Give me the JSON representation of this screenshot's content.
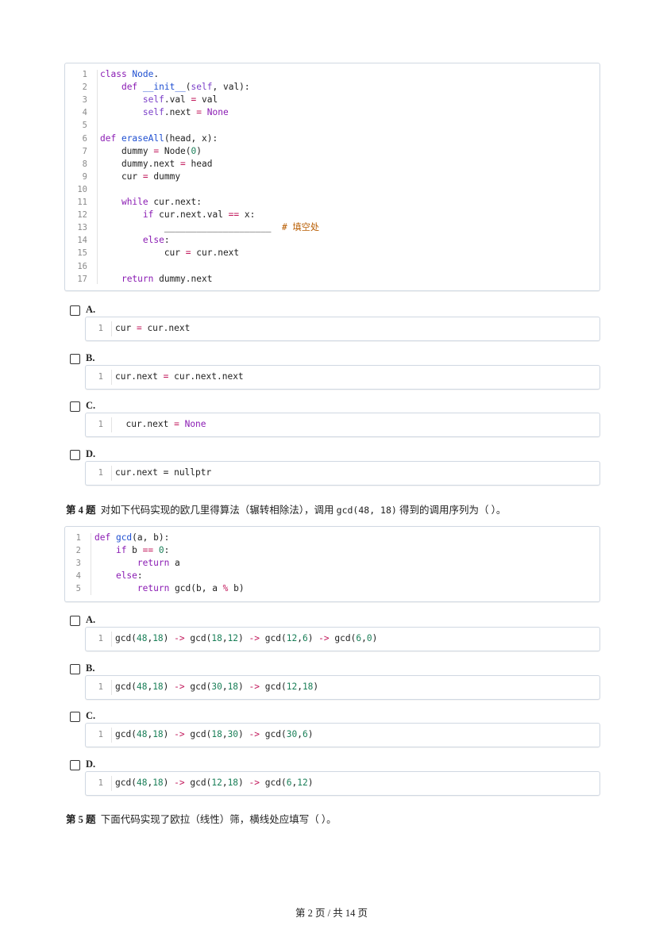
{
  "code1": {
    "lines": [
      {
        "n": "1",
        "parts": [
          [
            "kw",
            "class "
          ],
          [
            "fn",
            "Node"
          ],
          [
            "",
            "."
          ]
        ]
      },
      {
        "n": "2",
        "parts": [
          [
            "",
            "    "
          ],
          [
            "kw",
            "def "
          ],
          [
            "fn",
            "__init__"
          ],
          [
            "",
            "("
          ],
          [
            "slf",
            "self"
          ],
          [
            "",
            ", val):"
          ]
        ]
      },
      {
        "n": "3",
        "parts": [
          [
            "",
            "        "
          ],
          [
            "slf",
            "self"
          ],
          [
            "",
            ".val "
          ],
          [
            "op",
            "="
          ],
          [
            "",
            " val"
          ]
        ]
      },
      {
        "n": "4",
        "parts": [
          [
            "",
            "        "
          ],
          [
            "slf",
            "self"
          ],
          [
            "",
            ".next "
          ],
          [
            "op",
            "="
          ],
          [
            "kw",
            " None"
          ]
        ]
      },
      {
        "n": "5",
        "parts": []
      },
      {
        "n": "6",
        "parts": [
          [
            "kw",
            "def "
          ],
          [
            "fn",
            "eraseAll"
          ],
          [
            "",
            "(head, x):"
          ]
        ]
      },
      {
        "n": "7",
        "parts": [
          [
            "",
            "    dummy "
          ],
          [
            "op",
            "="
          ],
          [
            "",
            " Node("
          ],
          [
            "num",
            "0"
          ],
          [
            "",
            ")"
          ]
        ]
      },
      {
        "n": "8",
        "parts": [
          [
            "",
            "    dummy.next "
          ],
          [
            "op",
            "="
          ],
          [
            "",
            " head"
          ]
        ]
      },
      {
        "n": "9",
        "parts": [
          [
            "",
            "    cur "
          ],
          [
            "op",
            "="
          ],
          [
            "",
            " dummy"
          ]
        ]
      },
      {
        "n": "10",
        "parts": []
      },
      {
        "n": "11",
        "parts": [
          [
            "",
            "    "
          ],
          [
            "kw",
            "while"
          ],
          [
            "",
            " cur.next:"
          ]
        ]
      },
      {
        "n": "12",
        "parts": [
          [
            "",
            "        "
          ],
          [
            "kw",
            "if"
          ],
          [
            "",
            " cur.next.val "
          ],
          [
            "op",
            "=="
          ],
          [
            "",
            " x:"
          ]
        ]
      },
      {
        "n": "13",
        "parts": [
          [
            "",
            "            ____________________  "
          ],
          [
            "cm",
            "# 填空处"
          ]
        ]
      },
      {
        "n": "14",
        "parts": [
          [
            "",
            "        "
          ],
          [
            "kw",
            "else"
          ],
          [
            "",
            ":"
          ]
        ]
      },
      {
        "n": "15",
        "parts": [
          [
            "",
            "            cur "
          ],
          [
            "op",
            "="
          ],
          [
            "",
            " cur.next"
          ]
        ]
      },
      {
        "n": "16",
        "parts": []
      },
      {
        "n": "17",
        "parts": [
          [
            "",
            "    "
          ],
          [
            "kw",
            "return"
          ],
          [
            "",
            " dummy.next"
          ]
        ]
      }
    ]
  },
  "q3_options": [
    {
      "label": "A.",
      "n": "1",
      "parts": [
        [
          "",
          "cur "
        ],
        [
          "op",
          "="
        ],
        [
          "",
          " cur.next"
        ]
      ]
    },
    {
      "label": "B.",
      "n": "1",
      "parts": [
        [
          "",
          "cur.next "
        ],
        [
          "op",
          "="
        ],
        [
          "",
          " cur.next.next"
        ]
      ]
    },
    {
      "label": "C.",
      "n": "1",
      "parts": [
        [
          "",
          "  cur.next "
        ],
        [
          "op",
          "="
        ],
        [
          "kw",
          " None"
        ]
      ]
    },
    {
      "label": "D.",
      "n": "1",
      "parts": [
        [
          "",
          "cur.next = nullptr"
        ]
      ]
    }
  ],
  "q4": {
    "number": "第 4 题",
    "text_before": "对如下代码实现的欧几里得算法（辗转相除法），调用 ",
    "inline_code": "gcd(48, 18)",
    "text_after": " 得到的调用序列为（ ）。"
  },
  "code2": {
    "lines": [
      {
        "n": "1",
        "parts": [
          [
            "kw",
            "def "
          ],
          [
            "fn",
            "gcd"
          ],
          [
            "",
            "(a, b):"
          ]
        ]
      },
      {
        "n": "2",
        "parts": [
          [
            "",
            "    "
          ],
          [
            "kw",
            "if"
          ],
          [
            "",
            " b "
          ],
          [
            "op",
            "=="
          ],
          [
            "",
            " "
          ],
          [
            "num",
            "0"
          ],
          [
            "",
            ":"
          ]
        ]
      },
      {
        "n": "3",
        "parts": [
          [
            "",
            "        "
          ],
          [
            "kw",
            "return"
          ],
          [
            "",
            " a"
          ]
        ]
      },
      {
        "n": "4",
        "parts": [
          [
            "",
            "    "
          ],
          [
            "kw",
            "else"
          ],
          [
            "",
            ":"
          ]
        ]
      },
      {
        "n": "5",
        "parts": [
          [
            "",
            "        "
          ],
          [
            "kw",
            "return"
          ],
          [
            "",
            " gcd(b, a "
          ],
          [
            "op",
            "%"
          ],
          [
            "",
            " b)"
          ]
        ]
      }
    ]
  },
  "q4_options": [
    {
      "label": "A.",
      "n": "1",
      "parts": [
        [
          "",
          "gcd("
        ],
        [
          "num",
          "48"
        ],
        [
          "",
          ","
        ],
        [
          "num",
          "18"
        ],
        [
          "",
          ") "
        ],
        [
          "op",
          "->"
        ],
        [
          "",
          " gcd("
        ],
        [
          "num",
          "18"
        ],
        [
          "",
          ","
        ],
        [
          "num",
          "12"
        ],
        [
          "",
          ") "
        ],
        [
          "op",
          "->"
        ],
        [
          "",
          " gcd("
        ],
        [
          "num",
          "12"
        ],
        [
          "",
          ","
        ],
        [
          "num",
          "6"
        ],
        [
          "",
          ") "
        ],
        [
          "op",
          "->"
        ],
        [
          "",
          " gcd("
        ],
        [
          "num",
          "6"
        ],
        [
          "",
          ","
        ],
        [
          "num",
          "0"
        ],
        [
          "",
          ")"
        ]
      ]
    },
    {
      "label": "B.",
      "n": "1",
      "parts": [
        [
          "",
          "gcd("
        ],
        [
          "num",
          "48"
        ],
        [
          "",
          ","
        ],
        [
          "num",
          "18"
        ],
        [
          "",
          ") "
        ],
        [
          "op",
          "->"
        ],
        [
          "",
          " gcd("
        ],
        [
          "num",
          "30"
        ],
        [
          "",
          ","
        ],
        [
          "num",
          "18"
        ],
        [
          "",
          ") "
        ],
        [
          "op",
          "->"
        ],
        [
          "",
          " gcd("
        ],
        [
          "num",
          "12"
        ],
        [
          "",
          ","
        ],
        [
          "num",
          "18"
        ],
        [
          "",
          ")"
        ]
      ]
    },
    {
      "label": "C.",
      "n": "1",
      "parts": [
        [
          "",
          "gcd("
        ],
        [
          "num",
          "48"
        ],
        [
          "",
          ","
        ],
        [
          "num",
          "18"
        ],
        [
          "",
          ") "
        ],
        [
          "op",
          "->"
        ],
        [
          "",
          " gcd("
        ],
        [
          "num",
          "18"
        ],
        [
          "",
          ","
        ],
        [
          "num",
          "30"
        ],
        [
          "",
          ") "
        ],
        [
          "op",
          "->"
        ],
        [
          "",
          " gcd("
        ],
        [
          "num",
          "30"
        ],
        [
          "",
          ","
        ],
        [
          "num",
          "6"
        ],
        [
          "",
          ")"
        ]
      ]
    },
    {
      "label": "D.",
      "n": "1",
      "parts": [
        [
          "",
          "gcd("
        ],
        [
          "num",
          "48"
        ],
        [
          "",
          ","
        ],
        [
          "num",
          "18"
        ],
        [
          "",
          ") "
        ],
        [
          "op",
          "->"
        ],
        [
          "",
          " gcd("
        ],
        [
          "num",
          "12"
        ],
        [
          "",
          ","
        ],
        [
          "num",
          "18"
        ],
        [
          "",
          ") "
        ],
        [
          "op",
          "->"
        ],
        [
          "",
          " gcd("
        ],
        [
          "num",
          "6"
        ],
        [
          "",
          ","
        ],
        [
          "num",
          "12"
        ],
        [
          "",
          ")"
        ]
      ]
    }
  ],
  "q5": {
    "number": "第 5 题",
    "text": "下面代码实现了欧拉（线性）筛，横线处应填写（ ）。"
  },
  "footer": "第 2 页 / 共 14 页"
}
